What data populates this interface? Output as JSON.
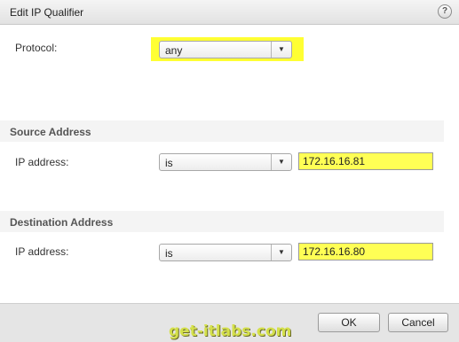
{
  "dialog": {
    "title": "Edit IP Qualifier",
    "help_icon": "question-icon",
    "help_glyph": "?"
  },
  "protocol": {
    "label": "Protocol:",
    "value": "any"
  },
  "source": {
    "header": "Source Address",
    "ip_label": "IP address:",
    "operator": "is",
    "ip_value": "172.16.16.81"
  },
  "destination": {
    "header": "Destination Address",
    "ip_label": "IP address:",
    "operator": "is",
    "ip_value": "172.16.16.80"
  },
  "buttons": {
    "ok": "OK",
    "cancel": "Cancel"
  },
  "watermark": "get-itlabs.com",
  "colors": {
    "highlight": "#ffff33",
    "section_bg": "#f4f4f4"
  }
}
